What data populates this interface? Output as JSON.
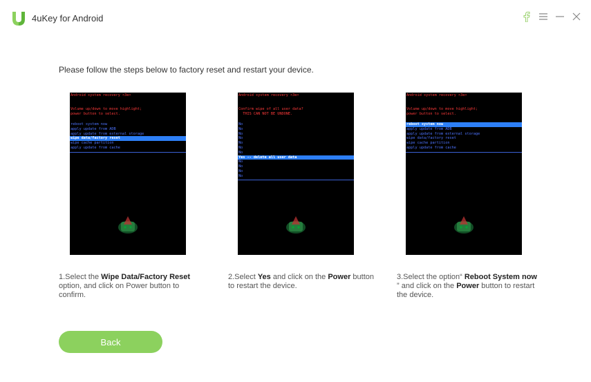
{
  "app": {
    "title": "4uKey for Android"
  },
  "window": {
    "icons": [
      "facebook-icon",
      "menu-icon",
      "minimize-icon",
      "close-icon"
    ]
  },
  "colors": {
    "accent": "#8cd15e",
    "screen_bg": "#000000",
    "recovery_header": "#ff3a3a",
    "menu_text": "#4e74ff",
    "menu_highlight": "#2d7ff6"
  },
  "instruction": "Please follow the steps below to factory reset and restart your device.",
  "steps": [
    {
      "screen": {
        "header": "Android system recovery <3e>",
        "instructions": "Volume up/down to move highlight;\npower button to select.",
        "menu": [
          "reboot system now",
          "apply update from ADB",
          "apply update from external storage",
          "wipe data/factory reset",
          "wipe cache partition",
          "apply update from cache"
        ],
        "selected": "wipe data/factory reset"
      },
      "caption": {
        "pre": "1.Select the ",
        "bold": "Wipe Data/Factory Reset",
        "post": "option, and click on Power button to confirm."
      }
    },
    {
      "screen": {
        "header": "Android system recovery <3e>",
        "instructions": "Confirm wipe of all user data?\n  THIS CAN NOT BE UNDONE.",
        "menu": [
          "No",
          "No",
          "No",
          "No",
          "No",
          "No",
          "No",
          "Yes -- delete all user data",
          "No",
          "No",
          "No",
          "No"
        ],
        "selected": "Yes -- delete all user data"
      },
      "caption": {
        "pre": "2.Select ",
        "bold": "Yes",
        "mid": " and click on the ",
        "bold2": "Power",
        "post": " button",
        "line2": "to restart the device."
      }
    },
    {
      "screen": {
        "header": "Android system recovery <3e>",
        "instructions": "Volume up/down to move highlight;\npower button to select.",
        "menu": [
          "reboot system now",
          "apply update from ADB",
          "apply update from external storage",
          "wipe data/factory reset",
          "wipe cache partition",
          "apply update from cache"
        ],
        "selected": "reboot system now"
      },
      "caption": {
        "pre": "3.Select the option“ ",
        "bold": "Reboot System now",
        "line2_pre": "” and click on the ",
        "bold2": "Power",
        "line2_post": " button to restart",
        "line3": "the device."
      }
    }
  ],
  "back_button": "Back"
}
